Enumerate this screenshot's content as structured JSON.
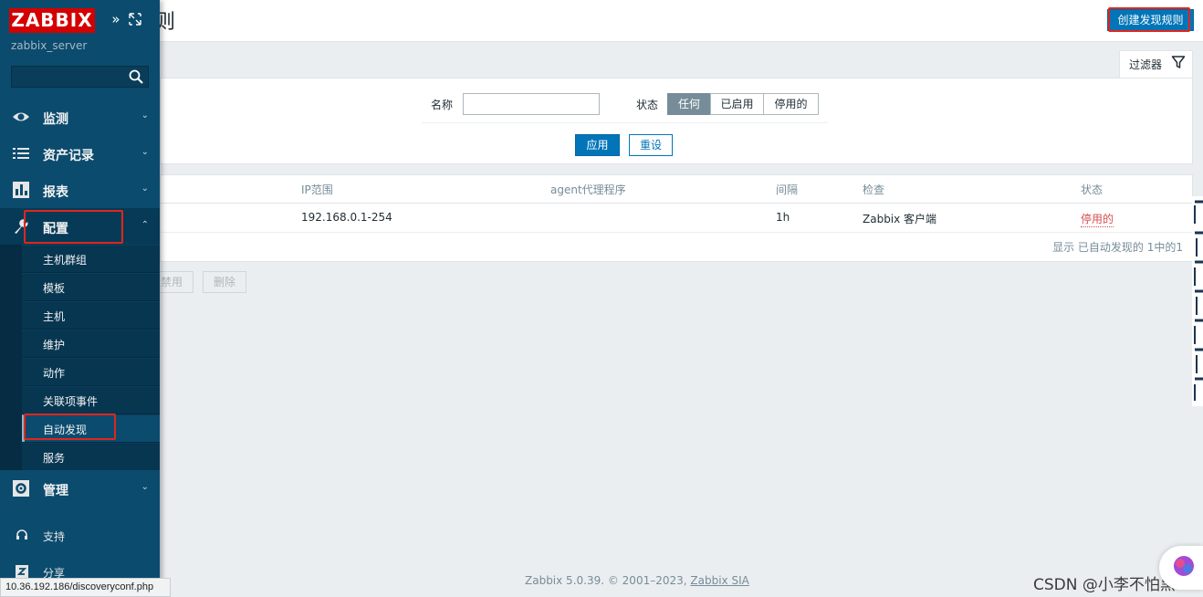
{
  "sidebar": {
    "logo": "ZABBIX",
    "server_name": "zabbix_server",
    "search_placeholder": "",
    "menu": [
      {
        "label": "监测"
      },
      {
        "label": "资产记录"
      },
      {
        "label": "报表"
      },
      {
        "label": "配置"
      },
      {
        "label": "管理"
      }
    ],
    "submenu": [
      "主机群组",
      "模板",
      "主机",
      "维护",
      "动作",
      "关联项事件",
      "自动发现",
      "服务"
    ],
    "extras": [
      {
        "label": "支持"
      },
      {
        "label": "分享"
      }
    ]
  },
  "header": {
    "title_partial": "则",
    "create_button": "创建发现规则"
  },
  "filter": {
    "tab_label": "过滤器",
    "name_label": "名称",
    "name_value": "",
    "status_label": "状态",
    "status_options": [
      "任何",
      "已启用",
      "停用的"
    ],
    "status_selected": "任何",
    "apply": "应用",
    "reset": "重设"
  },
  "table": {
    "columns": [
      "IP范围",
      "agent代理程序",
      "间隔",
      "检查",
      "状态"
    ],
    "rows": [
      {
        "ip_range": "192.168.0.1-254",
        "proxy": "",
        "interval": "1h",
        "checks": "Zabbix 客户端",
        "status": "停用的"
      }
    ],
    "footer": "显示 已自动发现的 1中的1"
  },
  "actions": {
    "disable": "禁用",
    "delete": "删除"
  },
  "footer": {
    "text": "Zabbix 5.0.39. © 2001–2023, ",
    "link": "Zabbix SIA"
  },
  "status_url": "10.36.192.186/discoveryconf.php",
  "watermark": "CSDN @小李不怕黑",
  "colors": {
    "sidebar": "#0b4b6e",
    "primary": "#0275b8",
    "logo": "#d40000",
    "highlight": "#e0261d",
    "disabled_status": "#d64e4e"
  }
}
